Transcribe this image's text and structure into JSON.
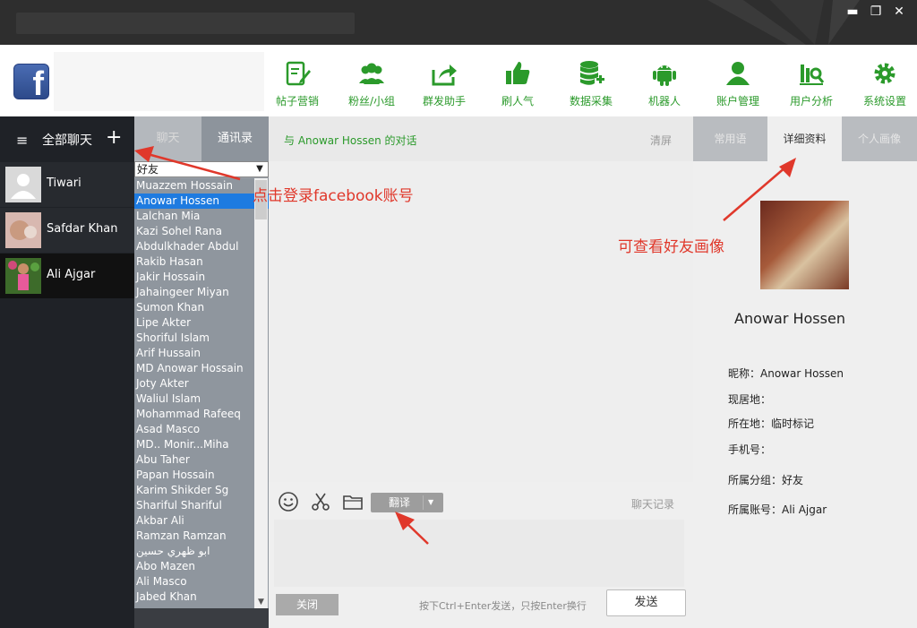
{
  "window": {
    "minimize": "▬",
    "restore": "❐",
    "close": "✕"
  },
  "toolbar": {
    "items": [
      {
        "label": "帖子营销",
        "icon": "edit-post-icon"
      },
      {
        "label": "粉丝/小组",
        "icon": "group-icon"
      },
      {
        "label": "群发助手",
        "icon": "share-icon"
      },
      {
        "label": "刷人气",
        "icon": "thumbs-up-icon"
      },
      {
        "label": "数据采集",
        "icon": "database-icon"
      },
      {
        "label": "机器人",
        "icon": "android-icon"
      },
      {
        "label": "账户管理",
        "icon": "user-icon"
      },
      {
        "label": "用户分析",
        "icon": "analytics-icon"
      },
      {
        "label": "系统设置",
        "icon": "gear-icon"
      }
    ],
    "accent": "#2b9a2b"
  },
  "sidebar": {
    "title": "全部聊天",
    "menu_icon": "≡",
    "add_icon": "+",
    "contacts": [
      {
        "name": "Tiwari"
      },
      {
        "name": "Safdar Khan"
      },
      {
        "name": "Ali Ajgar"
      }
    ]
  },
  "middle": {
    "tabs": [
      "聊天",
      "通讯录"
    ],
    "filter_value": "好友",
    "friends": [
      "Muazzem Hossain",
      "Anowar Hossen",
      "Lalchan Mia",
      "Kazi Sohel Rana",
      "Abdulkhader Abdul",
      "Rakib Hasan",
      "Jakir Hossain",
      "Jahaingeer Miyan",
      "Sumon Khan",
      "Lipe Akter",
      "Shoriful Islam",
      "Arif Hussain",
      "MD Anowar Hossain",
      "Joty Akter",
      "Waliul Islam",
      "Mohammad Rafeeq",
      "Asad Masco",
      "MD.. Monir...Miha",
      "Abu Taher",
      "Papan Hossain",
      "Karim Shikder Sg",
      "Shariful Shariful",
      "Akbar Ali",
      "Ramzan Ramzan",
      "ابو ظهري حسين",
      "Abo Mazen",
      "Ali Masco",
      "Jabed Khan"
    ],
    "selected_index": 1
  },
  "chat": {
    "title": "与 Anowar Hossen 的对话",
    "clear": "清屏",
    "translate": "翻译",
    "translate_arrow": "▼",
    "history": "聊天记录",
    "close": "关闭",
    "hint": "按下Ctrl+Enter发送，只按Enter换行",
    "send": "发送"
  },
  "profile": {
    "tabs": [
      "常用语",
      "详细资料",
      "个人画像"
    ],
    "name": "Anowar Hossen",
    "nickname": "昵称：Anowar Hossen",
    "residence": "现居地：",
    "location": "所在地：临时标记",
    "phone": "手机号：",
    "group": "所属分组：好友",
    "account": "所属账号：Ali Ajgar"
  },
  "annotations": {
    "login_hint": "点击登录facebook账号",
    "avatar_hint": "可查看好友画像",
    "color": "#e0382b"
  }
}
